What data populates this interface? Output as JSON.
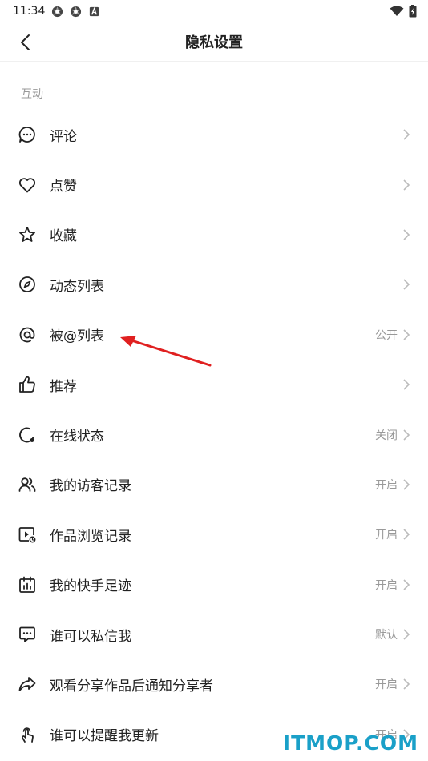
{
  "status_bar": {
    "time": "11:34"
  },
  "header": {
    "title": "隐私设置"
  },
  "section": {
    "label": "互动"
  },
  "items": [
    {
      "label": "评论",
      "value": "",
      "icon": "comment-icon"
    },
    {
      "label": "点赞",
      "value": "",
      "icon": "heart-icon"
    },
    {
      "label": "收藏",
      "value": "",
      "icon": "star-icon"
    },
    {
      "label": "动态列表",
      "value": "",
      "icon": "compass-icon"
    },
    {
      "label": "被@列表",
      "value": "公开",
      "icon": "at-icon"
    },
    {
      "label": "推荐",
      "value": "",
      "icon": "thumbs-up-icon"
    },
    {
      "label": "在线状态",
      "value": "关闭",
      "icon": "online-status-icon"
    },
    {
      "label": "我的访客记录",
      "value": "开启",
      "icon": "visitors-icon"
    },
    {
      "label": "作品浏览记录",
      "value": "开启",
      "icon": "video-history-icon"
    },
    {
      "label": "我的快手足迹",
      "value": "开启",
      "icon": "calendar-icon"
    },
    {
      "label": "谁可以私信我",
      "value": "默认",
      "icon": "message-icon"
    },
    {
      "label": "观看分享作品后通知分享者",
      "value": "开启",
      "icon": "share-icon"
    },
    {
      "label": "谁可以提醒我更新",
      "value": "开启",
      "icon": "touch-icon"
    }
  ],
  "watermark": {
    "text": "ITMOP.COM"
  },
  "colors": {
    "annotation_arrow": "#e02020",
    "watermark": "#1aa0c8"
  }
}
